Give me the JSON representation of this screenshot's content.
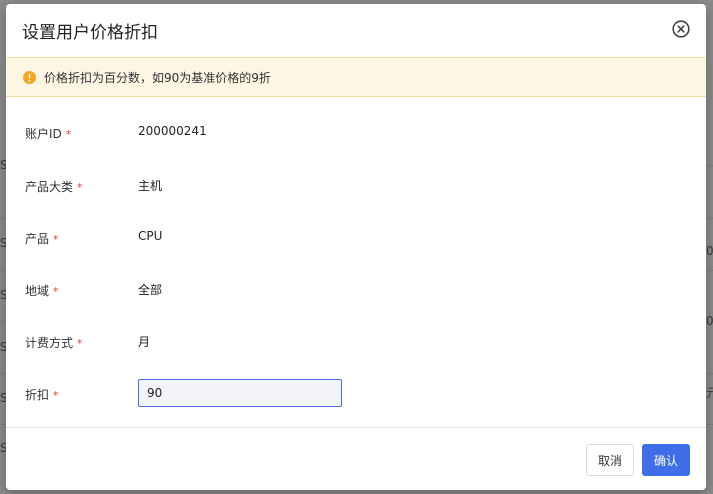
{
  "modal": {
    "title": "设置用户价格折扣",
    "alert_text": "价格折扣为百分数，如90为基准价格的9折",
    "fields": [
      {
        "label": "账户ID",
        "value": "200000241",
        "required": true
      },
      {
        "label": "产品大类",
        "value": "主机",
        "required": true
      },
      {
        "label": "产品",
        "value": "CPU",
        "required": true
      },
      {
        "label": "地域",
        "value": "全部",
        "required": true
      },
      {
        "label": "计费方式",
        "value": "月",
        "required": true
      }
    ],
    "discount": {
      "label": "折扣",
      "value": "90",
      "required": true
    },
    "required_mark": "*",
    "cancel_label": "取消",
    "confirm_label": "确认"
  },
  "background_fragments": {
    "left": [
      "Se",
      "Se",
      "Se",
      "Se",
      "Se",
      "Se"
    ],
    "right": [
      "0",
      "0",
      "元"
    ]
  },
  "colors": {
    "primary": "#3f6ee8",
    "alert_bg": "#fdf6e4",
    "alert_icon": "#f5a623",
    "required": "#e33a3a"
  },
  "icons": {
    "close": "close-circle-icon",
    "alert": "warning-circle-icon"
  }
}
